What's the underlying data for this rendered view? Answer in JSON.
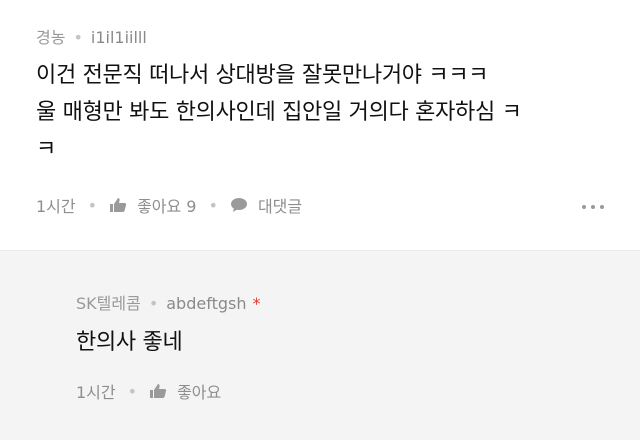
{
  "comment": {
    "author": "경농",
    "user_id": "i1il1iilll",
    "text_lines": [
      "이건 전문직 떠나서 상대방을 잘못만나거야 ㅋㅋㅋ",
      "울 매형만 봐도 한의사인데 집안일 거의다 혼자하심 ㅋ",
      "ㅋ"
    ],
    "time": "1시간",
    "like_label": "좋아요 9",
    "reply_label": "대댓글"
  },
  "reply": {
    "author": "SK텔레콤",
    "user_id": "abdeftgsh",
    "mark": "*",
    "text": "한의사 좋네",
    "time": "1시간",
    "like_label": "좋아요"
  }
}
